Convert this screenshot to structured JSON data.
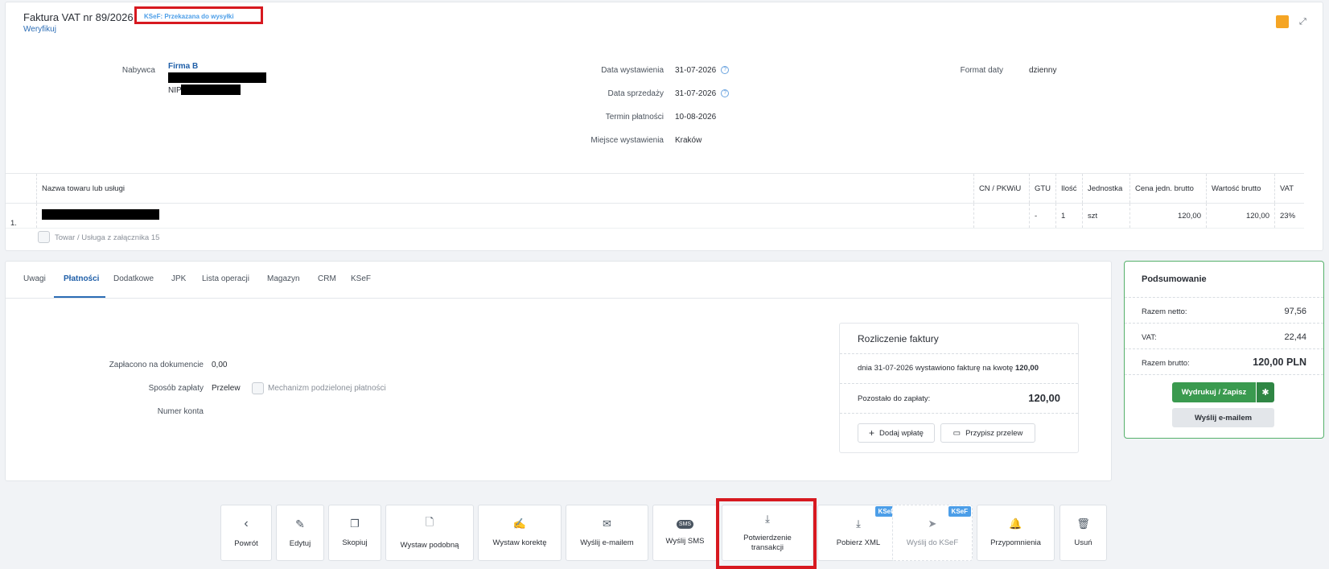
{
  "header": {
    "title": "Faktura VAT nr 89/2026",
    "ksef_status": "KSeF: Przekazana do wysyłki",
    "verify": "Weryfikuj"
  },
  "buyer": {
    "label": "Nabywca",
    "name": "Firma B",
    "nip_label": "NIP"
  },
  "dates": {
    "issue_label": "Data wystawienia",
    "issue_value": "31-07-2026",
    "sale_label": "Data sprzedaży",
    "sale_value": "31-07-2026",
    "due_label": "Termin płatności",
    "due_value": "10-08-2026",
    "place_label": "Miejsce wystawienia",
    "place_value": "Kraków",
    "format_label": "Format daty",
    "format_value": "dzienny"
  },
  "items": {
    "headers": [
      "Nazwa towaru lub usługi",
      "CN / PKWiU",
      "GTU",
      "Ilość",
      "Jednostka",
      "Cena jedn. brutto",
      "Wartość brutto",
      "VAT"
    ],
    "row": {
      "no": "1.",
      "cn": "",
      "gtu": "-",
      "qty": "1",
      "unit": "szt",
      "price": "120,00",
      "value": "120,00",
      "vat": "23%"
    },
    "attachment_label": "Towar / Usługa z załącznika 15"
  },
  "tabs": [
    "Uwagi",
    "Płatności",
    "Dodatkowe",
    "JPK",
    "Lista operacji",
    "Magazyn",
    "CRM",
    "KSeF"
  ],
  "payment": {
    "paid_label": "Zapłacono na dokumencie",
    "paid_value": "0,00",
    "method_label": "Sposób zapłaty",
    "method_value": "Przelew",
    "split_label": "Mechanizm podzielonej płatności",
    "account_label": "Numer konta"
  },
  "settlement": {
    "title": "Rozliczenie faktury",
    "line_text": "dnia 31-07-2026 wystawiono fakturę na kwotę",
    "line_amount": "120,00",
    "remaining_label": "Pozostało do zapłaty:",
    "remaining_value": "120,00",
    "add_payment": "Dodaj wpłatę",
    "assign_transfer": "Przypisz przelew"
  },
  "summary": {
    "title": "Podsumowanie",
    "net_label": "Razem netto:",
    "net_value": "97,56",
    "vat_label": "VAT:",
    "vat_value": "22,44",
    "gross_label": "Razem brutto:",
    "gross_value": "120,00 PLN",
    "print_button": "Wydrukuj / Zapisz",
    "email_button": "Wyślij e-mailem"
  },
  "actions": {
    "back": "Powrót",
    "edit": "Edytuj",
    "copy": "Skopiuj",
    "similar": "Wystaw podobną",
    "correction": "Wystaw korektę",
    "send_email": "Wyślij e-mailem",
    "send_sms": "Wyślij SMS",
    "confirm_line1": "Potwierdzenie",
    "confirm_line2": "transakcji",
    "download_xml": "Pobierz XML",
    "send_ksef": "Wyślij do KSeF",
    "reminders": "Przypomnienia",
    "delete": "Usuń",
    "ksef_tag": "KSeF"
  },
  "colors": {
    "accent": "#2c6db5",
    "green": "#3a9a4f",
    "highlight": "#d71920",
    "ksef_badge": "#4c9ee8"
  }
}
